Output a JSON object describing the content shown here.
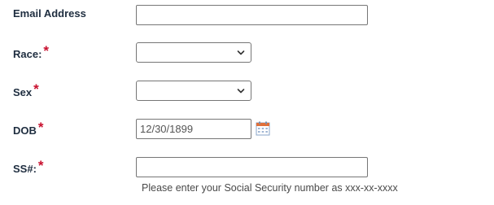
{
  "form": {
    "email": {
      "label": "Email Address",
      "value": ""
    },
    "race": {
      "label": "Race:",
      "required_mark": "*",
      "selected": ""
    },
    "sex": {
      "label": "Sex",
      "required_mark": "*",
      "selected": ""
    },
    "dob": {
      "label": "DOB",
      "required_mark": "*",
      "value": "12/30/1899",
      "calendar_icon": "calendar-icon"
    },
    "ssn": {
      "label": "SS#:",
      "required_mark": "*",
      "value": "",
      "help_text": "Please enter your Social Security number as xxx-xx-xxxx"
    }
  },
  "colors": {
    "label": "#1e2d3f",
    "required": "#c8102e",
    "input_border": "#767676",
    "help_text": "#4a4a4a"
  }
}
